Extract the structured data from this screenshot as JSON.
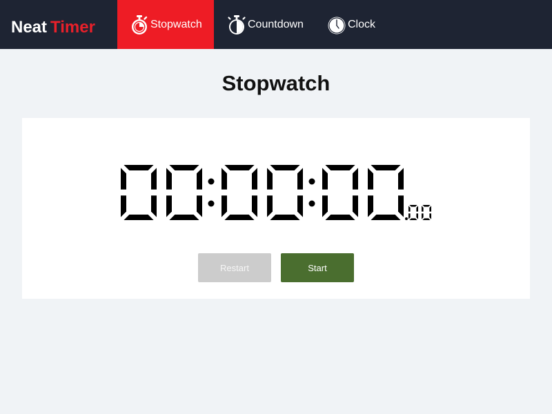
{
  "brand": {
    "word1": "Neat",
    "word2": "Timer",
    "accent_color": "#e8202a"
  },
  "nav": {
    "background": "#1e2433",
    "active_color": "#ee1c25",
    "tabs": [
      {
        "label": "Stopwatch",
        "icon": "stopwatch-icon",
        "active": true
      },
      {
        "label": "Countdown",
        "icon": "countdown-timer-icon",
        "active": false
      },
      {
        "label": "Clock",
        "icon": "clock-icon",
        "active": false
      }
    ]
  },
  "page": {
    "title": "Stopwatch"
  },
  "timer": {
    "hours": "00",
    "minutes": "00",
    "seconds": "00",
    "hundredths": "00"
  },
  "buttons": {
    "restart": {
      "label": "Restart",
      "enabled": false,
      "color": "#cccccc"
    },
    "start": {
      "label": "Start",
      "enabled": true,
      "color": "#4a6e2f"
    }
  }
}
